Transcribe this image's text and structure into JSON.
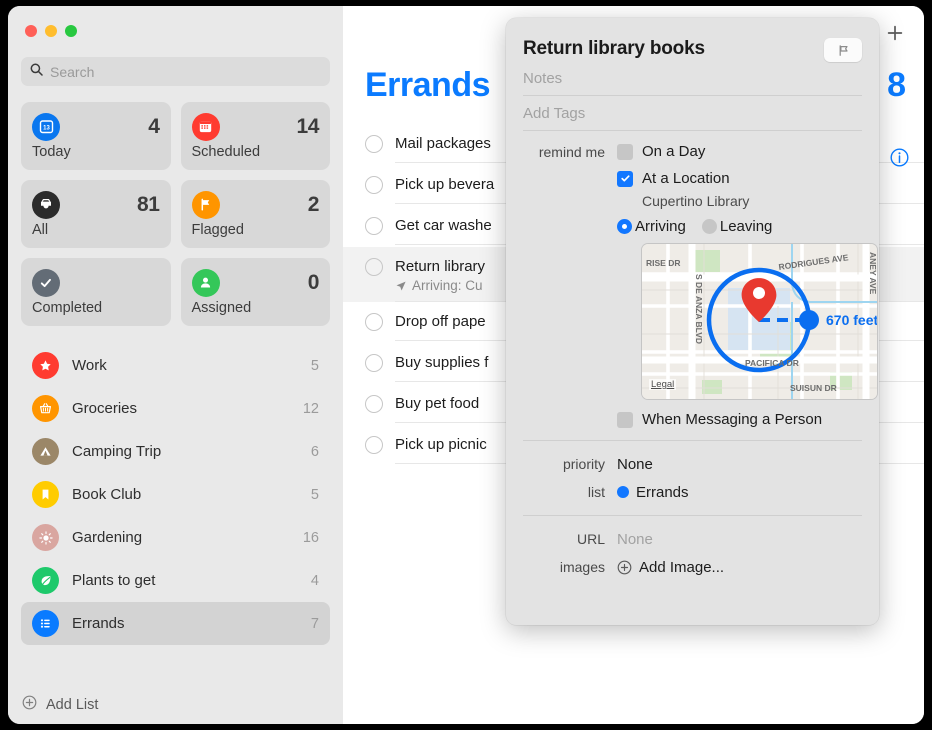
{
  "window": {
    "traffic_lights": [
      "close",
      "minimize",
      "zoom"
    ]
  },
  "sidebar": {
    "search": {
      "placeholder": "Search",
      "value": "",
      "icon": "search-icon"
    },
    "smart_lists": [
      {
        "label": "Today",
        "count": "4",
        "icon": "calendar-day-icon",
        "color": "#0a77ef"
      },
      {
        "label": "Scheduled",
        "count": "14",
        "icon": "calendar-icon",
        "color": "#ff3b30"
      },
      {
        "label": "All",
        "count": "81",
        "icon": "inbox-tray-icon",
        "color": "#2b2b2b"
      },
      {
        "label": "Flagged",
        "count": "2",
        "icon": "flag-icon",
        "color": "#ff9500"
      },
      {
        "label": "Completed",
        "count": "",
        "icon": "checkmark-icon",
        "color": "#636c76"
      },
      {
        "label": "Assigned",
        "count": "0",
        "icon": "person-icon",
        "color": "#34c759"
      }
    ],
    "lists": [
      {
        "label": "Work",
        "count": "5",
        "icon": "star-icon",
        "color": "#ff3b30",
        "selected": false
      },
      {
        "label": "Groceries",
        "count": "12",
        "icon": "basket-icon",
        "color": "#ff9500",
        "selected": false
      },
      {
        "label": "Camping Trip",
        "count": "6",
        "icon": "tent-icon",
        "color": "#9b8768",
        "selected": false
      },
      {
        "label": "Book Club",
        "count": "5",
        "icon": "bookmark-icon",
        "color": "#ffcc00",
        "selected": false
      },
      {
        "label": "Gardening",
        "count": "16",
        "icon": "sun-icon",
        "color": "#d9a6a0",
        "selected": false
      },
      {
        "label": "Plants to get",
        "count": "4",
        "icon": "leaf-icon",
        "color": "#1ec96b",
        "selected": false
      },
      {
        "label": "Errands",
        "count": "7",
        "icon": "list-icon",
        "color": "#0a7bff",
        "selected": true
      }
    ],
    "add_list": {
      "label": "Add List",
      "icon": "plus-circle-icon"
    }
  },
  "main": {
    "title": "Errands",
    "title_color": "#0b7bff",
    "total_count": "8",
    "add_button_icon": "plus-icon",
    "info_button_icon": "info-circle-icon",
    "reminders": [
      {
        "title": "Mail packages",
        "sub": "",
        "selected": false
      },
      {
        "title": "Pick up bevera",
        "sub": "",
        "selected": false
      },
      {
        "title": "Get car washe",
        "sub": "",
        "selected": false
      },
      {
        "title": "Return library",
        "sub": "Arriving: Cu",
        "selected": true
      },
      {
        "title": "Drop off pape",
        "sub": "",
        "selected": false
      },
      {
        "title": "Buy supplies f",
        "sub": "",
        "selected": false
      },
      {
        "title": "Buy pet food",
        "sub": "",
        "selected": false
      },
      {
        "title": "Pick up picnic",
        "sub": "",
        "selected": false
      }
    ]
  },
  "popover": {
    "title": "Return library books",
    "flag_button_icon": "flag-outline-icon",
    "notes_placeholder": "Notes",
    "tags_placeholder": "Add Tags",
    "remind_me_label": "remind me",
    "on_a_day": {
      "label": "On a Day",
      "checked": false
    },
    "at_a_location": {
      "label": "At a Location",
      "checked": true
    },
    "location_name": "Cupertino Library",
    "trigger_options": [
      {
        "label": "Arriving",
        "selected": true
      },
      {
        "label": "Leaving",
        "selected": false
      }
    ],
    "map": {
      "distance_label": "670 feet",
      "legal_label": "Legal",
      "streets": [
        "RISE DR",
        "S DE ANZA BLVD",
        "RODRIGUES AVE",
        "ANEY AVE",
        "PACIFICA DR",
        "SUISUN DR"
      ],
      "pin_icon": "map-pin-icon",
      "radius_color": "#0a6ef0",
      "pin_color": "#e8392f"
    },
    "when_messaging": {
      "label": "When Messaging a Person",
      "checked": false
    },
    "priority": {
      "key": "priority",
      "value": "None"
    },
    "list": {
      "key": "list",
      "value": "Errands",
      "color": "#1277ff"
    },
    "url": {
      "key": "URL",
      "value": "None"
    },
    "images": {
      "key": "images",
      "value": "Add Image...",
      "icon": "plus-circle-icon"
    }
  }
}
